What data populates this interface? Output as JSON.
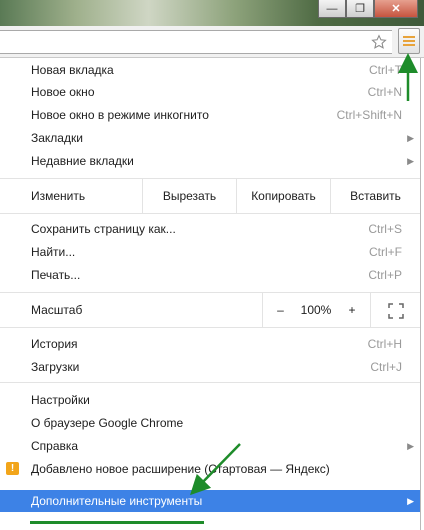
{
  "window": {
    "minimize_glyph": "—",
    "restore_glyph": "❐",
    "close_glyph": "✕"
  },
  "toolbar": {
    "star_icon": "star-icon",
    "menu_icon": "hamburger-icon",
    "accent": "#e8a33a"
  },
  "menu": {
    "new_tab": {
      "label": "Новая вкладка",
      "shortcut": "Ctrl+T"
    },
    "new_window": {
      "label": "Новое окно",
      "shortcut": "Ctrl+N"
    },
    "incognito": {
      "label": "Новое окно в режиме инкогнито",
      "shortcut": "Ctrl+Shift+N"
    },
    "bookmarks": {
      "label": "Закладки"
    },
    "recent_tabs": {
      "label": "Недавние вкладки"
    },
    "edit": {
      "label": "Изменить",
      "cut": "Вырезать",
      "copy": "Копировать",
      "paste": "Вставить"
    },
    "save_page": {
      "label": "Сохранить страницу как...",
      "shortcut": "Ctrl+S"
    },
    "find": {
      "label": "Найти...",
      "shortcut": "Ctrl+F"
    },
    "print": {
      "label": "Печать...",
      "shortcut": "Ctrl+P"
    },
    "zoom": {
      "label": "Масштаб",
      "minus": "–",
      "value": "100%",
      "plus": "+"
    },
    "history": {
      "label": "История",
      "shortcut": "Ctrl+H"
    },
    "downloads": {
      "label": "Загрузки",
      "shortcut": "Ctrl+J"
    },
    "settings": {
      "label": "Настройки"
    },
    "about": {
      "label": "О браузере Google Chrome"
    },
    "help": {
      "label": "Справка"
    },
    "extension_added": {
      "label": "Добавлено новое расширение (Стартовая — Яндекс)",
      "badge": "!"
    },
    "more_tools": {
      "label": "Дополнительные инструменты"
    }
  },
  "colors": {
    "highlight": "#3d82e6",
    "annotation_green": "#1e8c2a",
    "warning": "#f2a51a"
  }
}
